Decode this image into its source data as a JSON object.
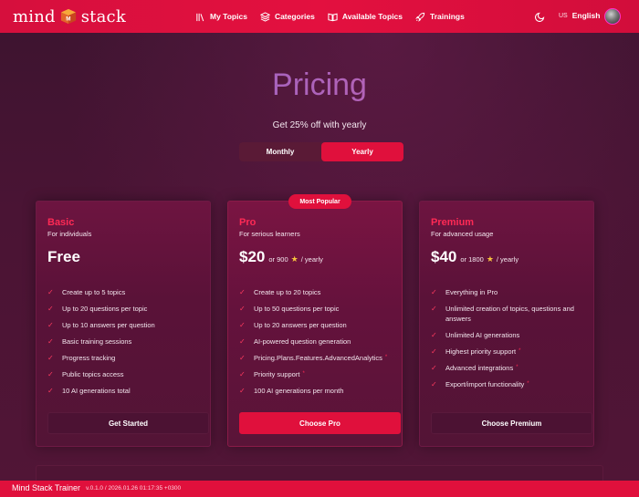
{
  "brand": {
    "left": "mind",
    "right": "stack"
  },
  "nav": {
    "items": [
      {
        "label": "My Topics",
        "icon": "library-icon"
      },
      {
        "label": "Categories",
        "icon": "layers-icon"
      },
      {
        "label": "Available Topics",
        "icon": "book-open-icon"
      },
      {
        "label": "Trainings",
        "icon": "rocket-icon"
      }
    ],
    "language_flag": "US",
    "language": "English"
  },
  "page": {
    "title": "Pricing",
    "subtitle": "Get 25% off with yearly",
    "billing_toggle": {
      "monthly": "Monthly",
      "yearly": "Yearly",
      "selected": "Yearly"
    },
    "popular_badge": "Most Popular"
  },
  "plans": [
    {
      "name": "Basic",
      "description": "For individuals",
      "price": "Free",
      "price_extra": "",
      "features": [
        {
          "text": "Create up to 5 topics",
          "marked": false
        },
        {
          "text": "Up to 20 questions per topic",
          "marked": false
        },
        {
          "text": "Up to 10 answers per question",
          "marked": false
        },
        {
          "text": "Basic training sessions",
          "marked": false
        },
        {
          "text": "Progress tracking",
          "marked": false
        },
        {
          "text": "Public topics access",
          "marked": false
        },
        {
          "text": "10 AI generations total",
          "marked": false
        }
      ],
      "button": "Get Started"
    },
    {
      "name": "Pro",
      "description": "For serious learners",
      "price": "$20",
      "price_extra": "or 900",
      "price_suffix": "/ yearly",
      "features": [
        {
          "text": "Create up to 20 topics",
          "marked": false
        },
        {
          "text": "Up to 50 questions per topic",
          "marked": false
        },
        {
          "text": "Up to 20 answers per question",
          "marked": false
        },
        {
          "text": "AI-powered question generation",
          "marked": false
        },
        {
          "text": "Pricing.Plans.Features.AdvancedAnalytics",
          "marked": true
        },
        {
          "text": "Priority support",
          "marked": true
        },
        {
          "text": "100 AI generations per month",
          "marked": false
        }
      ],
      "button": "Choose Pro"
    },
    {
      "name": "Premium",
      "description": "For advanced usage",
      "price": "$40",
      "price_extra": "or 1800",
      "price_suffix": "/ yearly",
      "features": [
        {
          "text": "Everything in Pro",
          "marked": false
        },
        {
          "text": "Unlimited creation of topics, questions and answers",
          "marked": false
        },
        {
          "text": "Unlimited AI generations",
          "marked": false
        },
        {
          "text": "Highest priority support",
          "marked": true
        },
        {
          "text": "Advanced integrations",
          "marked": true
        },
        {
          "text": "Export/import functionality",
          "marked": true
        }
      ],
      "button": "Choose Premium"
    }
  ],
  "footer": {
    "name": "Mind Stack Trainer",
    "version": "v.0.1.0 / 2026.01.26 01:17:35 +0300"
  },
  "colors": {
    "accent": "#e0103c",
    "plan_name": "#ff2a55",
    "background": "#4a1434"
  }
}
